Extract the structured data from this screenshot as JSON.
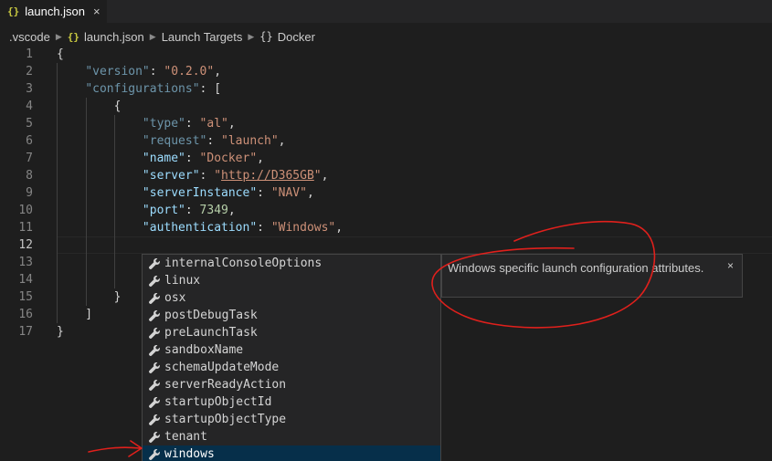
{
  "tab": {
    "icon": "{}",
    "label": "launch.json",
    "close": "×"
  },
  "breadcrumb": {
    "folder": ".vscode",
    "file_icon": "{}",
    "file": "launch.json",
    "section": "Launch Targets",
    "item_icon": "{}",
    "item": "Docker"
  },
  "editor": {
    "active_line": 12,
    "lines": [
      {
        "n": "1",
        "tokens": [
          {
            "c": "k-plain",
            "t": "{"
          }
        ]
      },
      {
        "n": "2",
        "tokens": [
          {
            "c": "k-plain",
            "t": "    "
          },
          {
            "c": "k-keyalt",
            "t": "\"version\""
          },
          {
            "c": "k-plain",
            "t": ": "
          },
          {
            "c": "k-str",
            "t": "\"0.2.0\""
          },
          {
            "c": "k-plain",
            "t": ","
          }
        ]
      },
      {
        "n": "3",
        "tokens": [
          {
            "c": "k-plain",
            "t": "    "
          },
          {
            "c": "k-keyalt",
            "t": "\"configurations\""
          },
          {
            "c": "k-plain",
            "t": ": ["
          }
        ]
      },
      {
        "n": "4",
        "tokens": [
          {
            "c": "k-plain",
            "t": "        {"
          }
        ]
      },
      {
        "n": "5",
        "tokens": [
          {
            "c": "k-plain",
            "t": "            "
          },
          {
            "c": "k-keyalt",
            "t": "\"type\""
          },
          {
            "c": "k-plain",
            "t": ": "
          },
          {
            "c": "k-str",
            "t": "\"al\""
          },
          {
            "c": "k-plain",
            "t": ","
          }
        ]
      },
      {
        "n": "6",
        "tokens": [
          {
            "c": "k-plain",
            "t": "            "
          },
          {
            "c": "k-keyalt",
            "t": "\"request\""
          },
          {
            "c": "k-plain",
            "t": ": "
          },
          {
            "c": "k-str",
            "t": "\"launch\""
          },
          {
            "c": "k-plain",
            "t": ","
          }
        ]
      },
      {
        "n": "7",
        "tokens": [
          {
            "c": "k-plain",
            "t": "            "
          },
          {
            "c": "k-key",
            "t": "\"name\""
          },
          {
            "c": "k-plain",
            "t": ": "
          },
          {
            "c": "k-str",
            "t": "\"Docker\""
          },
          {
            "c": "k-plain",
            "t": ","
          }
        ]
      },
      {
        "n": "8",
        "tokens": [
          {
            "c": "k-plain",
            "t": "            "
          },
          {
            "c": "k-key",
            "t": "\"server\""
          },
          {
            "c": "k-plain",
            "t": ": "
          },
          {
            "c": "k-str",
            "t": "\""
          },
          {
            "c": "k-url",
            "t": "http://D365GB"
          },
          {
            "c": "k-str",
            "t": "\""
          },
          {
            "c": "k-plain",
            "t": ","
          }
        ]
      },
      {
        "n": "9",
        "tokens": [
          {
            "c": "k-plain",
            "t": "            "
          },
          {
            "c": "k-key",
            "t": "\"serverInstance\""
          },
          {
            "c": "k-plain",
            "t": ": "
          },
          {
            "c": "k-str",
            "t": "\"NAV\""
          },
          {
            "c": "k-plain",
            "t": ","
          }
        ]
      },
      {
        "n": "10",
        "tokens": [
          {
            "c": "k-plain",
            "t": "            "
          },
          {
            "c": "k-key",
            "t": "\"port\""
          },
          {
            "c": "k-plain",
            "t": ": "
          },
          {
            "c": "k-num",
            "t": "7349"
          },
          {
            "c": "k-plain",
            "t": ","
          }
        ]
      },
      {
        "n": "11",
        "tokens": [
          {
            "c": "k-plain",
            "t": "            "
          },
          {
            "c": "k-key",
            "t": "\"authentication\""
          },
          {
            "c": "k-plain",
            "t": ": "
          },
          {
            "c": "k-str",
            "t": "\"Windows\""
          },
          {
            "c": "k-plain",
            "t": ","
          }
        ]
      },
      {
        "n": "12",
        "tokens": []
      },
      {
        "n": "13",
        "tokens": []
      },
      {
        "n": "14",
        "tokens": []
      },
      {
        "n": "15",
        "tokens": [
          {
            "c": "k-plain",
            "t": "        }"
          }
        ]
      },
      {
        "n": "16",
        "tokens": [
          {
            "c": "k-plain",
            "t": "    ]"
          }
        ]
      },
      {
        "n": "17",
        "tokens": [
          {
            "c": "k-plain",
            "t": "}"
          }
        ]
      }
    ]
  },
  "suggestions": {
    "icon": "wrench-icon",
    "selected_index": 11,
    "items": [
      "internalConsoleOptions",
      "linux",
      "osx",
      "postDebugTask",
      "preLaunchTask",
      "sandboxName",
      "schemaUpdateMode",
      "serverReadyAction",
      "startupObjectId",
      "startupObjectType",
      "tenant",
      "windows"
    ]
  },
  "details": {
    "text": "Windows specific launch configuration attributes.",
    "close": "×"
  },
  "colors": {
    "background": "#1e1e1e",
    "selection": "#062f4a",
    "annotation": "#e0201c"
  }
}
